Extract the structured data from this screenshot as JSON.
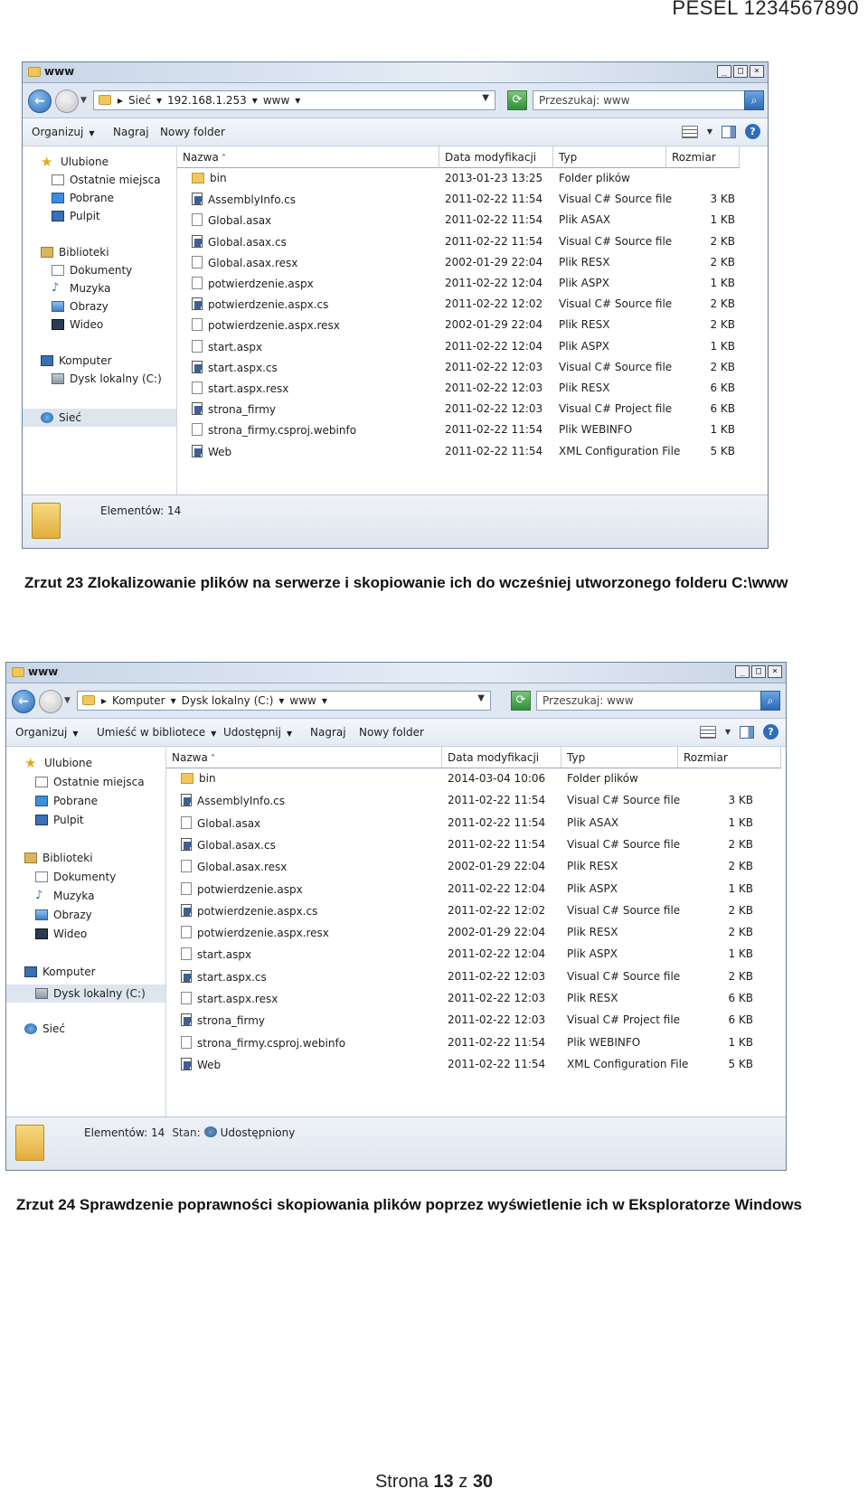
{
  "header": {
    "pesel": "PESEL  1234567890"
  },
  "window1": {
    "title": "www",
    "crumbs": [
      "Sieć",
      "192.168.1.253",
      "www"
    ],
    "search_placeholder": "Przeszukaj: www",
    "toolbar": [
      "Organizuj",
      "Nagraj",
      "Nowy folder"
    ],
    "columns": [
      "Nazwa",
      "Data modyfikacji",
      "Typ",
      "Rozmiar"
    ],
    "nav": {
      "favorites": "Ulubione",
      "recent": "Ostatnie miejsca",
      "downloads": "Pobrane",
      "desktop": "Pulpit",
      "libraries": "Biblioteki",
      "documents": "Dokumenty",
      "music": "Muzyka",
      "pictures": "Obrazy",
      "videos": "Wideo",
      "computer": "Komputer",
      "local_disk": "Dysk lokalny (C:)",
      "network": "Sieć"
    },
    "selected_nav": "network",
    "files": [
      {
        "name": "bin",
        "date": "2013-01-23 13:25",
        "type": "Folder plików",
        "size": "",
        "icon": "folder-icon"
      },
      {
        "name": "AssemblyInfo.cs",
        "date": "2011-02-22 11:54",
        "type": "Visual C# Source file",
        "size": "3 KB",
        "icon": "cs-file-icon"
      },
      {
        "name": "Global.asax",
        "date": "2011-02-22 11:54",
        "type": "Plik ASAX",
        "size": "1 KB",
        "icon": "blank-file-icon"
      },
      {
        "name": "Global.asax.cs",
        "date": "2011-02-22 11:54",
        "type": "Visual C# Source file",
        "size": "2 KB",
        "icon": "cs-file-icon"
      },
      {
        "name": "Global.asax.resx",
        "date": "2002-01-29 22:04",
        "type": "Plik RESX",
        "size": "2 KB",
        "icon": "blank-file-icon"
      },
      {
        "name": "potwierdzenie.aspx",
        "date": "2011-02-22 12:04",
        "type": "Plik ASPX",
        "size": "1 KB",
        "icon": "blank-file-icon"
      },
      {
        "name": "potwierdzenie.aspx.cs",
        "date": "2011-02-22 12:02",
        "type": "Visual C# Source file",
        "size": "2 KB",
        "icon": "cs-file-icon"
      },
      {
        "name": "potwierdzenie.aspx.resx",
        "date": "2002-01-29 22:04",
        "type": "Plik RESX",
        "size": "2 KB",
        "icon": "blank-file-icon"
      },
      {
        "name": "start.aspx",
        "date": "2011-02-22 12:04",
        "type": "Plik ASPX",
        "size": "1 KB",
        "icon": "blank-file-icon"
      },
      {
        "name": "start.aspx.cs",
        "date": "2011-02-22 12:03",
        "type": "Visual C# Source file",
        "size": "2 KB",
        "icon": "cs-file-icon"
      },
      {
        "name": "start.aspx.resx",
        "date": "2011-02-22 12:03",
        "type": "Plik RESX",
        "size": "6 KB",
        "icon": "blank-file-icon"
      },
      {
        "name": "strona_firmy",
        "date": "2011-02-22 12:03",
        "type": "Visual C# Project file",
        "size": "6 KB",
        "icon": "cs-file-icon"
      },
      {
        "name": "strona_firmy.csproj.webinfo",
        "date": "2011-02-22 11:54",
        "type": "Plik WEBINFO",
        "size": "1 KB",
        "icon": "blank-file-icon"
      },
      {
        "name": "Web",
        "date": "2011-02-22 11:54",
        "type": "XML Configuration File",
        "size": "5 KB",
        "icon": "cs-file-icon"
      }
    ],
    "status_count": "Elementów: 14",
    "status_state_label": "",
    "status_state_value": ""
  },
  "caption1": "Zrzut 23 Zlokalizowanie plików na serwerze i skopiowanie ich do wcześniej utworzonego folderu C:\\www",
  "window2": {
    "title": "www",
    "crumbs": [
      "Komputer",
      "Dysk lokalny (C:)",
      "www"
    ],
    "search_placeholder": "Przeszukaj: www",
    "toolbar": [
      "Organizuj",
      "Umieść w bibliotece",
      "Udostępnij",
      "Nagraj",
      "Nowy folder"
    ],
    "columns": [
      "Nazwa",
      "Data modyfikacji",
      "Typ",
      "Rozmiar"
    ],
    "nav": {
      "favorites": "Ulubione",
      "recent": "Ostatnie miejsca",
      "downloads": "Pobrane",
      "desktop": "Pulpit",
      "libraries": "Biblioteki",
      "documents": "Dokumenty",
      "music": "Muzyka",
      "pictures": "Obrazy",
      "videos": "Wideo",
      "computer": "Komputer",
      "local_disk": "Dysk lokalny (C:)",
      "network": "Sieć"
    },
    "selected_nav": "local_disk",
    "files": [
      {
        "name": "bin",
        "date": "2014-03-04 10:06",
        "type": "Folder plików",
        "size": "",
        "icon": "folder-icon"
      },
      {
        "name": "AssemblyInfo.cs",
        "date": "2011-02-22 11:54",
        "type": "Visual C# Source file",
        "size": "3 KB",
        "icon": "cs-file-icon"
      },
      {
        "name": "Global.asax",
        "date": "2011-02-22 11:54",
        "type": "Plik ASAX",
        "size": "1 KB",
        "icon": "blank-file-icon"
      },
      {
        "name": "Global.asax.cs",
        "date": "2011-02-22 11:54",
        "type": "Visual C# Source file",
        "size": "2 KB",
        "icon": "cs-file-icon"
      },
      {
        "name": "Global.asax.resx",
        "date": "2002-01-29 22:04",
        "type": "Plik RESX",
        "size": "2 KB",
        "icon": "blank-file-icon"
      },
      {
        "name": "potwierdzenie.aspx",
        "date": "2011-02-22 12:04",
        "type": "Plik ASPX",
        "size": "1 KB",
        "icon": "blank-file-icon"
      },
      {
        "name": "potwierdzenie.aspx.cs",
        "date": "2011-02-22 12:02",
        "type": "Visual C# Source file",
        "size": "2 KB",
        "icon": "cs-file-icon"
      },
      {
        "name": "potwierdzenie.aspx.resx",
        "date": "2002-01-29 22:04",
        "type": "Plik RESX",
        "size": "2 KB",
        "icon": "blank-file-icon"
      },
      {
        "name": "start.aspx",
        "date": "2011-02-22 12:04",
        "type": "Plik ASPX",
        "size": "1 KB",
        "icon": "blank-file-icon"
      },
      {
        "name": "start.aspx.cs",
        "date": "2011-02-22 12:03",
        "type": "Visual C# Source file",
        "size": "2 KB",
        "icon": "cs-file-icon"
      },
      {
        "name": "start.aspx.resx",
        "date": "2011-02-22 12:03",
        "type": "Plik RESX",
        "size": "6 KB",
        "icon": "blank-file-icon"
      },
      {
        "name": "strona_firmy",
        "date": "2011-02-22 12:03",
        "type": "Visual C# Project file",
        "size": "6 KB",
        "icon": "cs-file-icon"
      },
      {
        "name": "strona_firmy.csproj.webinfo",
        "date": "2011-02-22 11:54",
        "type": "Plik WEBINFO",
        "size": "1 KB",
        "icon": "blank-file-icon"
      },
      {
        "name": "Web",
        "date": "2011-02-22 11:54",
        "type": "XML Configuration File",
        "size": "5 KB",
        "icon": "cs-file-icon"
      }
    ],
    "status_count": "Elementów: 14",
    "status_state_label": "Stan:",
    "status_state_value": "Udostępniony"
  },
  "caption2": "Zrzut 24 Sprawdzenie poprawności skopiowania plików poprzez wyświetlenie ich w Eksploratorze Windows",
  "footer": {
    "prefix": "Strona",
    "page": "13",
    "sep": "z",
    "total": "30"
  }
}
